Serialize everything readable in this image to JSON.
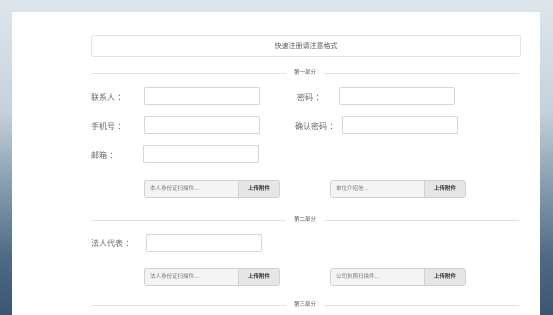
{
  "form": {
    "title": "快速注册请注意格式",
    "sections": [
      "第一部分",
      "第二部分",
      "第三部分"
    ],
    "fields": {
      "contact_label": "联系人 ：",
      "password_label": "密码 ：",
      "phone_label": "手机号 ：",
      "confirm_password_label": "确认密码 ：",
      "email_label": "邮箱 ：",
      "legal_rep_label": "法人代表 ："
    },
    "uploads": {
      "id_scan_1": {
        "filename": "本人身份证扫描件...",
        "button": "上传附件"
      },
      "unit_letter": {
        "filename": "单位介绍信...",
        "button": "上传附件"
      },
      "legal_id_scan": {
        "filename": "法人身份证扫描件...",
        "button": "上传附件"
      },
      "business_license": {
        "filename": "公司执照扫描件...",
        "button": "上传附件"
      }
    }
  }
}
